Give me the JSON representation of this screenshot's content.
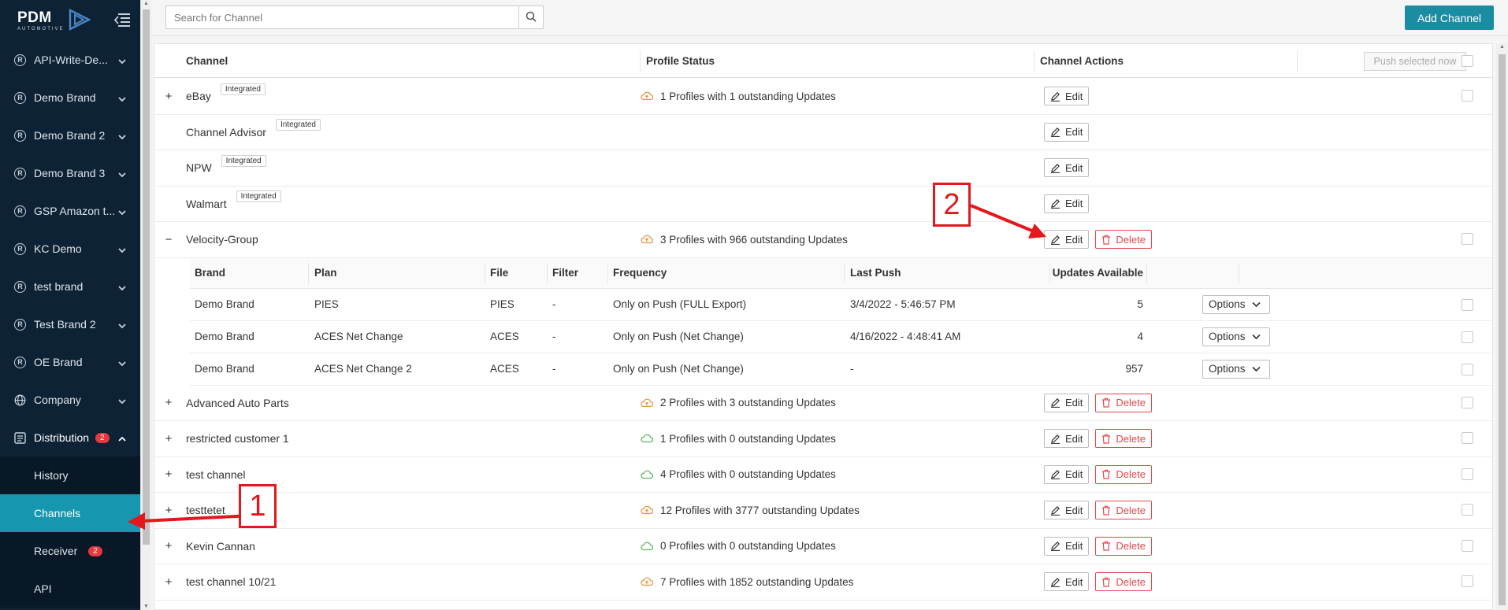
{
  "brand": {
    "logo_text": "PDM",
    "logo_sub": "AUTOMOTIVE"
  },
  "sidebar": {
    "items": [
      {
        "label": "API-Write-De...",
        "icon": "R"
      },
      {
        "label": "Demo Brand",
        "icon": "R"
      },
      {
        "label": "Demo Brand 2",
        "icon": "R"
      },
      {
        "label": "Demo Brand 3",
        "icon": "R"
      },
      {
        "label": "GSP Amazon t...",
        "icon": "R"
      },
      {
        "label": "KC Demo",
        "icon": "R"
      },
      {
        "label": "test brand",
        "icon": "R"
      },
      {
        "label": "Test Brand 2",
        "icon": "R"
      },
      {
        "label": "OE Brand",
        "icon": "R"
      },
      {
        "label": "Company",
        "icon": "globe"
      }
    ],
    "distribution": {
      "label": "Distribution",
      "badge": "2"
    },
    "sub_items": [
      {
        "label": "History"
      },
      {
        "label": "Channels",
        "active": true
      },
      {
        "label": "Receiver",
        "badge": "2"
      },
      {
        "label": "API"
      }
    ]
  },
  "search": {
    "placeholder": "Search for Channel"
  },
  "add_channel_label": "Add Channel",
  "table": {
    "headers": {
      "channel": "Channel",
      "status": "Profile Status",
      "actions": "Channel Actions"
    },
    "push_selected_label": "Push selected now",
    "edit_label": "Edit",
    "delete_label": "Delete",
    "integrated_label": "Integrated",
    "rows": [
      {
        "expander": "+",
        "name": "eBay",
        "integrated": true,
        "status": "1 Profiles with 1 outstanding Updates",
        "status_kind": "pending",
        "delete": false,
        "checkbox": true
      },
      {
        "expander": "",
        "name": "Channel Advisor",
        "integrated": true,
        "status": "",
        "status_kind": "",
        "delete": false,
        "checkbox": false
      },
      {
        "expander": "",
        "name": "NPW",
        "integrated": true,
        "status": "",
        "status_kind": "",
        "delete": false,
        "checkbox": false
      },
      {
        "expander": "",
        "name": "Walmart",
        "integrated": true,
        "status": "",
        "status_kind": "",
        "delete": false,
        "checkbox": false
      },
      {
        "expander": "−",
        "name": "Velocity-Group",
        "integrated": false,
        "status": "3 Profiles with 966 outstanding Updates",
        "status_kind": "pending",
        "delete": true,
        "checkbox": true
      },
      {
        "expander": "+",
        "name": "Advanced Auto Parts",
        "integrated": false,
        "status": "2 Profiles with 3 outstanding Updates",
        "status_kind": "pending",
        "delete": true,
        "checkbox": true
      },
      {
        "expander": "+",
        "name": "restricted customer 1",
        "integrated": false,
        "status": "1 Profiles with 0 outstanding Updates",
        "status_kind": "ok",
        "delete": true,
        "checkbox": true
      },
      {
        "expander": "+",
        "name": "test channel",
        "integrated": false,
        "status": "4 Profiles with 0 outstanding Updates",
        "status_kind": "ok",
        "delete": true,
        "checkbox": true
      },
      {
        "expander": "+",
        "name": "testtetet",
        "integrated": false,
        "status": "12 Profiles with 3777 outstanding Updates",
        "status_kind": "pending",
        "delete": true,
        "checkbox": true
      },
      {
        "expander": "+",
        "name": "Kevin Cannan",
        "integrated": false,
        "status": "0 Profiles with 0 outstanding Updates",
        "status_kind": "ok",
        "delete": true,
        "checkbox": true
      },
      {
        "expander": "+",
        "name": "test channel 10/21",
        "integrated": false,
        "status": "7 Profiles with 1852 outstanding Updates",
        "status_kind": "pending",
        "delete": true,
        "checkbox": true
      }
    ],
    "subtable": {
      "headers": {
        "brand": "Brand",
        "plan": "Plan",
        "file": "File",
        "filter": "Filter",
        "frequency": "Frequency",
        "last_push": "Last Push",
        "updates": "Updates Available"
      },
      "options_label": "Options",
      "rows": [
        {
          "brand": "Demo Brand",
          "plan": "PIES",
          "file": "PIES",
          "filter": "-",
          "frequency": "Only on Push (FULL Export)",
          "last_push": "3/4/2022 - 5:46:57 PM",
          "updates": "5"
        },
        {
          "brand": "Demo Brand",
          "plan": "ACES Net Change",
          "file": "ACES",
          "filter": "-",
          "frequency": "Only on Push (Net Change)",
          "last_push": "4/16/2022 - 4:48:41 AM",
          "updates": "4"
        },
        {
          "brand": "Demo Brand",
          "plan": "ACES Net Change 2",
          "file": "ACES",
          "filter": "-",
          "frequency": "Only on Push (Net Change)",
          "last_push": "-",
          "updates": "957"
        }
      ]
    }
  },
  "annotations": {
    "callout_1": "1",
    "callout_2": "2"
  },
  "colors": {
    "accent": "#1a8da3",
    "sidebar": "#0e2235",
    "danger": "#e0484d",
    "pending": "#e8953b",
    "ok": "#5cb85c",
    "callout": "#e4171d"
  }
}
